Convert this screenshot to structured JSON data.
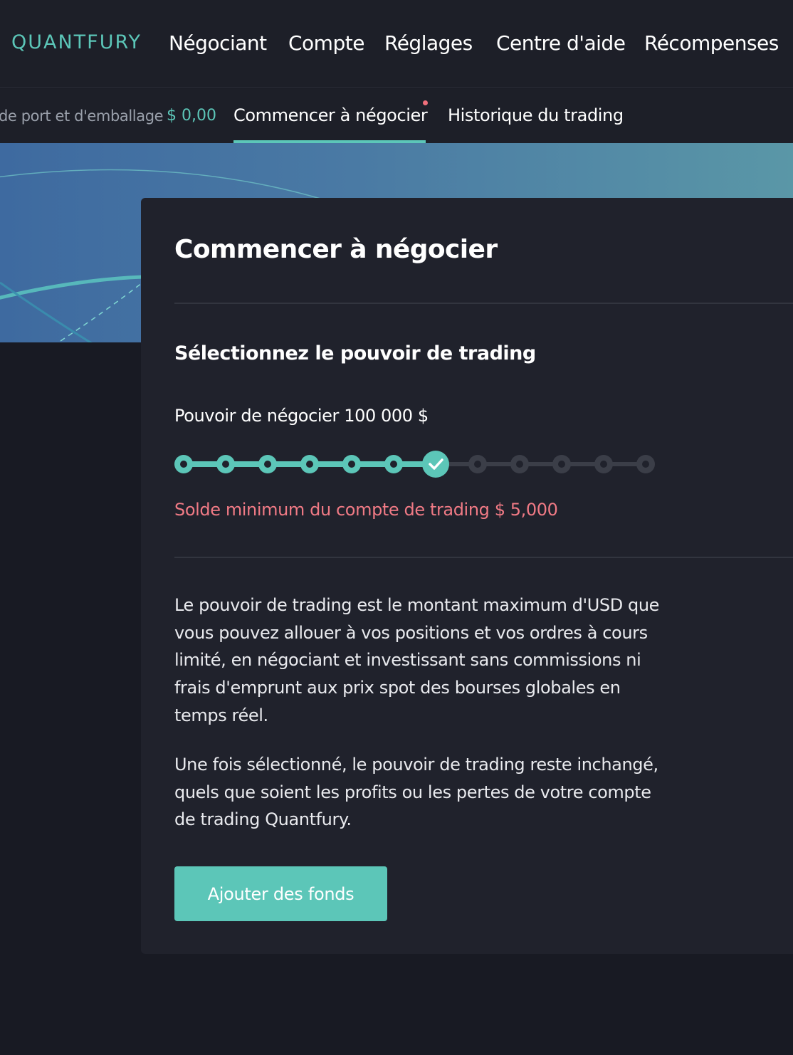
{
  "nav": {
    "logo": "QUANTFURY",
    "links": [
      "Négociant",
      "Compte",
      "Réglages",
      "Centre d'aide",
      "Récompenses"
    ]
  },
  "subnav": {
    "fee_label": "de port et d'emballage",
    "fee_value": "$ 0,00",
    "tabs": [
      "Commencer à négocier",
      "Historique du trading"
    ],
    "active_tab": "Commencer à négocier"
  },
  "card": {
    "title": "Commencer à négocier",
    "section_title": "Sélectionnez le pouvoir de trading",
    "power_label": "Pouvoir de négocier 100 000 $",
    "slider": {
      "steps": 12,
      "selected_step": 7
    },
    "min_balance": "Solde minimum du compte de trading $ 5,000",
    "paragraph_1": "Le pouvoir de trading est le montant maximum d'USD que vous pouvez allouer à vos positions et vos ordres à cours limité, en négociant et investissant sans commissions ni frais d'emprunt aux prix spot des bourses globales en temps réel.",
    "paragraph_2": "Une fois sélectionné, le pouvoir de trading reste inchangé, quels que soient les profits ou les pertes de votre compte de trading Quantfury.",
    "button_label": "Ajouter des fonds"
  },
  "colors": {
    "accent": "#5cc6b8",
    "warning": "#f07a85",
    "background": "#181a23",
    "card": "#20222c"
  }
}
